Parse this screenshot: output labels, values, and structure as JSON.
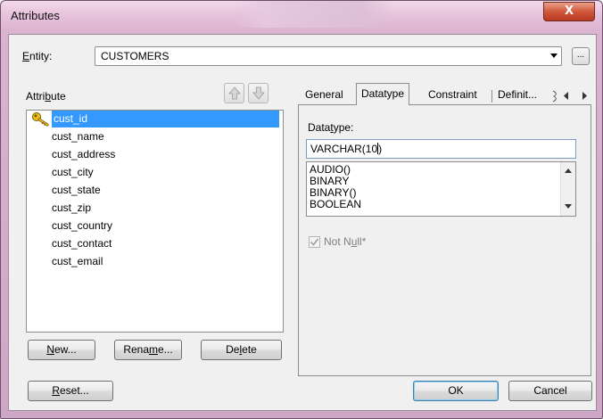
{
  "window": {
    "title": "Attributes",
    "close_icon": "close-icon",
    "close_glyph": "X"
  },
  "entity": {
    "label": "Entity:",
    "value": "CUSTOMERS",
    "ellipsis": "..."
  },
  "attribute_panel": {
    "label": "Attribute",
    "items": [
      {
        "name": "cust_id",
        "selected": true,
        "icon": "key-icon"
      },
      {
        "name": "cust_name"
      },
      {
        "name": "cust_address"
      },
      {
        "name": "cust_city"
      },
      {
        "name": "cust_state"
      },
      {
        "name": "cust_zip"
      },
      {
        "name": "cust_country"
      },
      {
        "name": "cust_contact"
      },
      {
        "name": "cust_email"
      }
    ],
    "new_btn": "New...",
    "rename_btn": "Rename...",
    "delete_btn": "Delete"
  },
  "tabs": {
    "items": [
      "General",
      "Datatype",
      "Constraint",
      "Definit..."
    ],
    "active": "Datatype"
  },
  "datatype_tab": {
    "label": "Datatype:",
    "value": "VARCHAR(10)",
    "options": [
      "AUDIO()",
      "BINARY",
      "BINARY()",
      "BOOLEAN"
    ],
    "not_null_label": "Not Null*",
    "not_null_checked": true
  },
  "footer": {
    "reset_btn": "Reset...",
    "ok_btn": "OK",
    "cancel_btn": "Cancel"
  },
  "colors": {
    "selection": "#3399ff",
    "window_frame": "#d9b3cf",
    "close_button": "#c8452a"
  }
}
